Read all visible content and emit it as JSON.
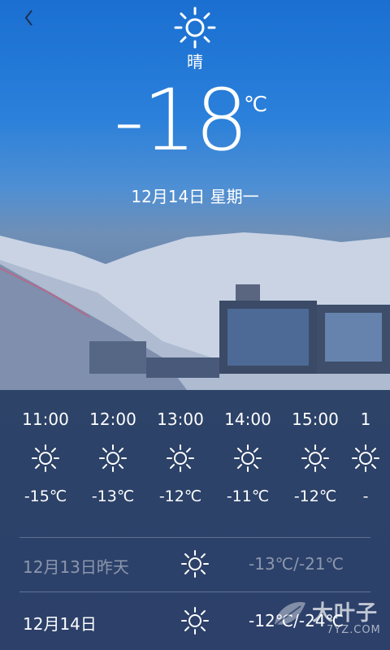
{
  "current": {
    "condition": "晴",
    "temperature": "-18",
    "unit": "℃",
    "date": "12月14日 星期一",
    "icon": "sun-icon"
  },
  "hourly": [
    {
      "time": "11:00",
      "temp": "-15℃",
      "icon": "sun-icon"
    },
    {
      "time": "12:00",
      "temp": "-13℃",
      "icon": "sun-icon"
    },
    {
      "time": "13:00",
      "temp": "-12℃",
      "icon": "sun-icon"
    },
    {
      "time": "14:00",
      "temp": "-11℃",
      "icon": "sun-icon"
    },
    {
      "time": "15:00",
      "temp": "-12℃",
      "icon": "sun-icon"
    },
    {
      "time": "1",
      "temp": "-",
      "icon": "sun-icon"
    }
  ],
  "daily": [
    {
      "date": "12月13日昨天",
      "range": "-13℃/-21℃",
      "icon": "sun-icon",
      "muted": true
    },
    {
      "date": "12月14日",
      "range": "-12℃/-24℃",
      "icon": "sun-icon",
      "muted": false
    }
  ],
  "watermark": {
    "text": "大叶子",
    "sub": "7YZ.COM"
  }
}
